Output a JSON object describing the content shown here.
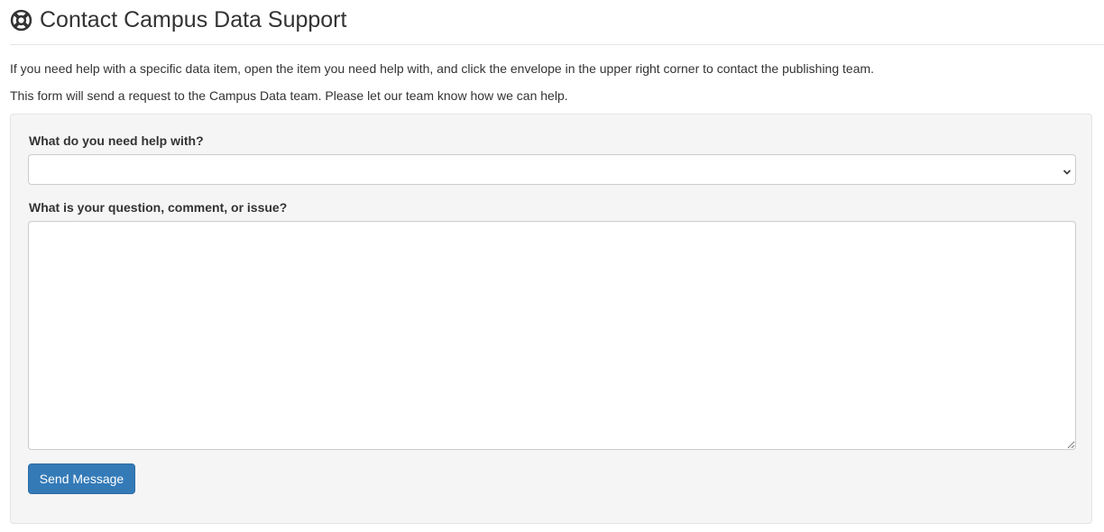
{
  "header": {
    "title": "Contact Campus Data Support",
    "icon": "life-ring-icon"
  },
  "intro": {
    "line1": "If you need help with a specific data item, open the item you need help with, and click the envelope in the upper right corner to contact the publishing team.",
    "line2": "This form will send a request to the Campus Data team. Please let our team know how we can help."
  },
  "form": {
    "help_topic_label": "What do you need help with?",
    "help_topic_value": "",
    "question_label": "What is your question, comment, or issue?",
    "question_value": "",
    "submit_label": "Send Message"
  },
  "colors": {
    "primary": "#337ab7",
    "well_background": "#f5f5f5",
    "text": "#333333"
  }
}
